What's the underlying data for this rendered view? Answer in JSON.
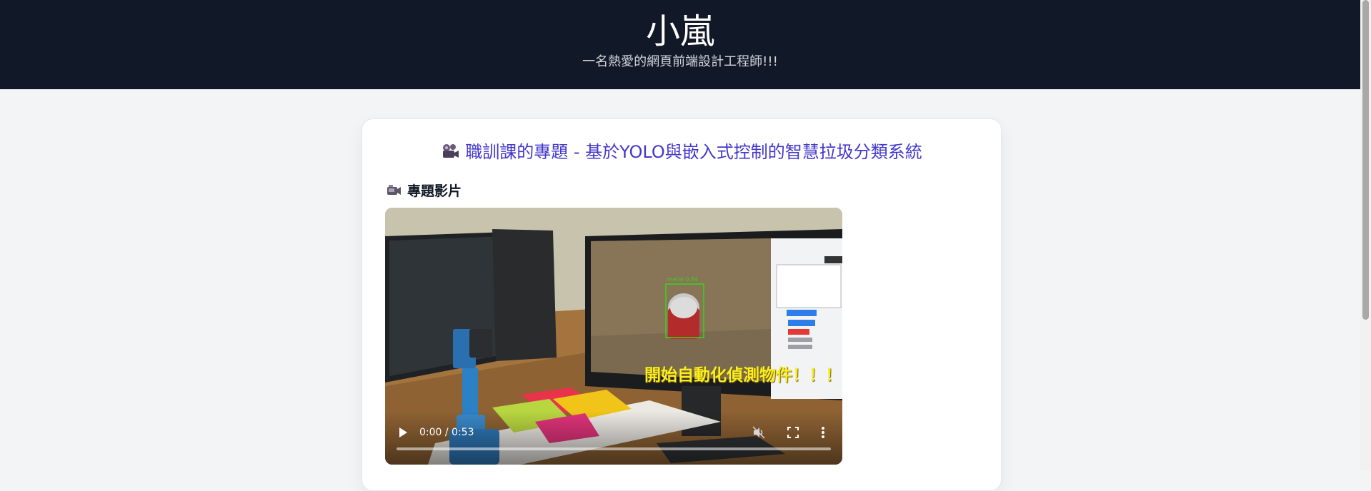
{
  "header": {
    "title": "小嵐",
    "subtitle": "一名熱愛的網頁前端設計工程師!!!"
  },
  "project": {
    "title_icon": "movie-camera-icon",
    "title": "職訓課的專題 - 基於YOLO與嵌入式控制的智慧拉圾分類系統",
    "section_icon": "video-camera-icon",
    "section_label": "專題影片"
  },
  "video": {
    "overlay_caption": "開始自動化偵測物件！！！",
    "detection_label": "metal 0.84",
    "time": "0:00 / 0:53",
    "progress": 0,
    "icons": [
      "play-icon",
      "volume-icon",
      "fullscreen-icon",
      "more-vertical-icon"
    ]
  },
  "colors": {
    "header_bg": "#111827",
    "title_accent": "#4338ca",
    "caption_yellow": "#f7ef24",
    "detection_green": "#39d31a"
  }
}
